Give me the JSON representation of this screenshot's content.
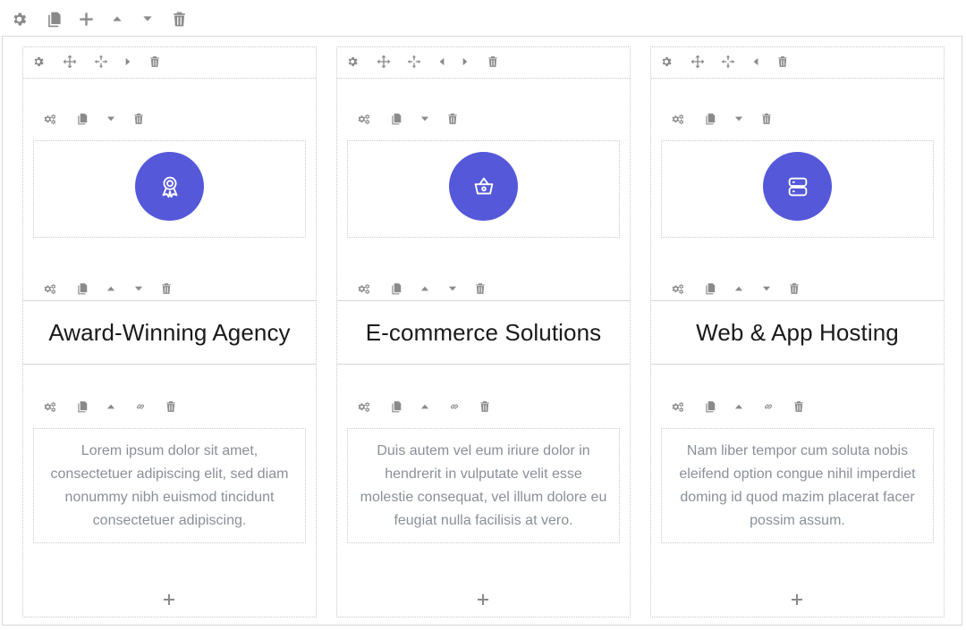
{
  "top_toolbar": {
    "icons": [
      "gear-icon",
      "duplicate-icon",
      "plus-icon",
      "caret-up-icon",
      "caret-down-icon",
      "trash-icon"
    ]
  },
  "columns": [
    {
      "icon": "award-ribbon-icon",
      "heading": "Award-Winning Agency",
      "text": "Lorem ipsum dolor sit amet, consectetuer adipiscing elit, sed diam nonummy nibh euismod tincidunt consectetuer adipiscing.",
      "column_toolbar": [
        "gear-icon",
        "move-icon",
        "resize-icon",
        "caret-right-icon",
        "trash-icon"
      ]
    },
    {
      "icon": "shopping-basket-icon",
      "heading": "E-commerce Solutions",
      "text": "Duis autem vel eum iriure dolor in hendrerit in vulputate velit esse molestie consequat, vel illum dolore eu feugiat nulla facilisis at vero.",
      "column_toolbar": [
        "gear-icon",
        "move-icon",
        "resize-icon",
        "caret-left-icon",
        "caret-right-icon",
        "trash-icon"
      ]
    },
    {
      "icon": "server-icon",
      "heading": "Web & App Hosting",
      "text": "Nam liber tempor cum soluta nobis eleifend option congue nihil imperdiet doming id quod mazim placerat facer possim assum.",
      "column_toolbar": [
        "gear-icon",
        "move-icon",
        "resize-icon",
        "caret-left-icon",
        "trash-icon"
      ]
    }
  ],
  "colors": {
    "accent": "#5558d9",
    "icon_gray": "#8a8a8a",
    "body_text": "#8a8f98",
    "heading_text": "#1a1a1a"
  }
}
